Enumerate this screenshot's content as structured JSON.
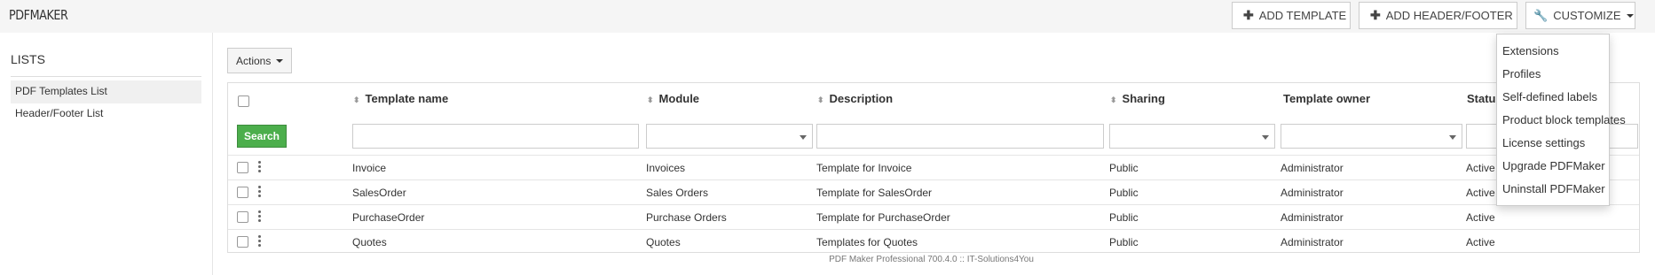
{
  "app": {
    "title": "PDFMAKER"
  },
  "toolbar": {
    "add_template": "ADD TEMPLATE",
    "add_header_footer": "ADD HEADER/FOOTER",
    "customize": "CUSTOMIZE"
  },
  "sidebar": {
    "title": "LISTS",
    "items": [
      {
        "label": "PDF Templates List",
        "active": true
      },
      {
        "label": "Header/Footer List",
        "active": false
      }
    ]
  },
  "actions_label": "Actions",
  "search_label": "Search",
  "table": {
    "headers": [
      "Template name",
      "Module",
      "Description",
      "Sharing",
      "Template owner",
      "Status"
    ],
    "rows": [
      {
        "name": "Invoice",
        "module": "Invoices",
        "description": "Template for Invoice",
        "sharing": "Public",
        "owner": "Administrator",
        "status": "Active"
      },
      {
        "name": "SalesOrder",
        "module": "Sales Orders",
        "description": "Template for SalesOrder",
        "sharing": "Public",
        "owner": "Administrator",
        "status": "Active"
      },
      {
        "name": "PurchaseOrder",
        "module": "Purchase Orders",
        "description": "Template for PurchaseOrder",
        "sharing": "Public",
        "owner": "Administrator",
        "status": "Active"
      },
      {
        "name": "Quotes",
        "module": "Quotes",
        "description": "Templates for Quotes",
        "sharing": "Public",
        "owner": "Administrator",
        "status": "Active"
      }
    ]
  },
  "customize_menu": {
    "items": [
      "Extensions",
      "Profiles",
      "Self-defined labels",
      "Product block templates",
      "License settings",
      "Upgrade PDFMaker",
      "Uninstall PDFMaker"
    ]
  },
  "footer": {
    "text": "PDF Maker Professional 700.4.0 :: IT-Solutions4You"
  },
  "colors": {
    "search_button": "#4cae4c",
    "topbar_bg": "#f5f5f5"
  },
  "icons": {
    "plus": "plus-icon",
    "wrench": "wrench-icon",
    "sort": "sort-icon",
    "kebab": "kebab-menu-icon"
  }
}
